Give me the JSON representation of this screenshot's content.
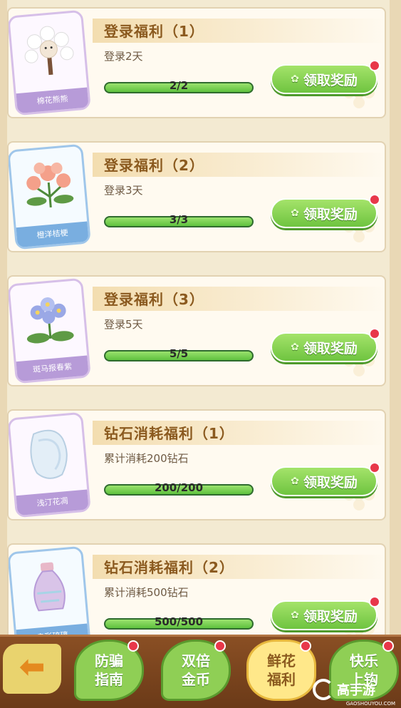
{
  "cards": [
    {
      "title": "登录福利（1）",
      "desc": "登录2天",
      "progress": "2/2",
      "fill": 1.0,
      "button": "领取奖励",
      "reward_label": "棉花熊熊",
      "thumb_style": "purple"
    },
    {
      "title": "登录福利（2）",
      "desc": "登录3天",
      "progress": "3/3",
      "fill": 1.0,
      "button": "领取奖励",
      "reward_label": "橙洋桔梗",
      "thumb_style": "blue"
    },
    {
      "title": "登录福利（3）",
      "desc": "登录5天",
      "progress": "5/5",
      "fill": 1.0,
      "button": "领取奖励",
      "reward_label": "斑马报春紫",
      "thumb_style": "purple"
    },
    {
      "title": "钻石消耗福利（1）",
      "desc": "累计消耗200钻石",
      "progress": "200/200",
      "fill": 1.0,
      "button": "领取奖励",
      "reward_label": "浅汀花凋",
      "thumb_style": "purple"
    },
    {
      "title": "钻石消耗福利（2）",
      "desc": "累计消耗500钻石",
      "progress": "500/500",
      "fill": 1.0,
      "button": "领取奖励",
      "reward_label": "幸彩琉璃",
      "thumb_style": "blue"
    }
  ],
  "bottom_nav": {
    "back_icon": "back-arrow-icon",
    "tabs": [
      {
        "label": "防骗指南",
        "line1": "防骗",
        "line2": "指南",
        "active": false
      },
      {
        "label": "双倍金币",
        "line1": "双倍",
        "line2": "金币",
        "active": false
      },
      {
        "label": "鲜花福利",
        "line1": "鲜花",
        "line2": "福利",
        "active": true
      },
      {
        "label": "快乐上钩",
        "line1": "快乐",
        "line2": "上钩",
        "active": false
      }
    ]
  },
  "watermark": {
    "text": "高手游",
    "sub": "GAOSHOUYOU.COM"
  },
  "colors": {
    "title": "#8b5a1f",
    "button_green": "#6fc440",
    "badge_red": "#e8374a",
    "bar_green": "#5ec13e",
    "bottom_brown": "#7a4520"
  }
}
